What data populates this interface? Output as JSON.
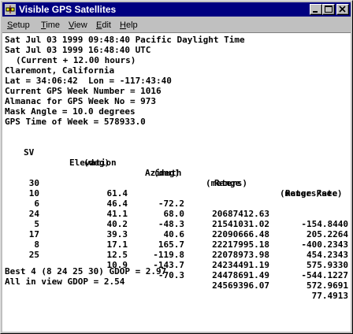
{
  "window": {
    "title": "Visible GPS Satellites",
    "icon": "satellite-app-icon"
  },
  "menu": [
    {
      "label": "Setup",
      "accel": "S",
      "rest": "etup"
    },
    {
      "label": "Time",
      "accel": "T",
      "rest": "ime"
    },
    {
      "label": "View",
      "accel": "V",
      "rest": "iew"
    },
    {
      "label": "Edit",
      "accel": "E",
      "rest": "dit"
    },
    {
      "label": "Help",
      "accel": "H",
      "rest": "elp"
    }
  ],
  "info": {
    "local_time": "Sat Jul 03 1999 09:48:40 Pacific Daylight Time",
    "utc_time": "Sat Jul 03 1999 16:48:40 UTC",
    "offset": "(Current + 12.00 hours)",
    "location": "Claremont, California",
    "coords": "Lat = 34:06:42  Lon = -117:43:40",
    "gps_week": "Current GPS Week Number = 1016",
    "almanac_week": "Almanac for GPS Week No = 973",
    "mask_angle": "Mask Angle = 10.0 degrees",
    "gps_time_of_week": "GPS Time of Week = 578933.0"
  },
  "table": {
    "headers": {
      "sv": "SV",
      "elevation": "Elevation",
      "azimuth": "Azimuth",
      "range": "Range",
      "range_rate": "Range Rate",
      "elevation_unit": "(deg)",
      "azimuth_unit": "(deg)",
      "range_unit": "(meters)",
      "range_rate_unit": "(meters/sec)"
    },
    "rows": [
      {
        "sv": "30",
        "elevation": "61.4",
        "azimuth": "-72.2",
        "range": "20687412.63",
        "range_rate": "-154.8440"
      },
      {
        "sv": "10",
        "elevation": "46.4",
        "azimuth": "68.0",
        "range": "21541031.02",
        "range_rate": "205.2264"
      },
      {
        "sv": "6",
        "elevation": "41.1",
        "azimuth": "-48.3",
        "range": "22090666.48",
        "range_rate": "-400.2343"
      },
      {
        "sv": "24",
        "elevation": "40.2",
        "azimuth": "40.6",
        "range": "22217995.18",
        "range_rate": "454.2343"
      },
      {
        "sv": "5",
        "elevation": "39.3",
        "azimuth": "165.7",
        "range": "22078973.98",
        "range_rate": "575.9330"
      },
      {
        "sv": "17",
        "elevation": "17.1",
        "azimuth": "-119.8",
        "range": "24234491.19",
        "range_rate": "-544.1227"
      },
      {
        "sv": "8",
        "elevation": "12.5",
        "azimuth": "-143.7",
        "range": "24478691.49",
        "range_rate": "572.9691"
      },
      {
        "sv": "25",
        "elevation": "10.9",
        "azimuth": "-70.3",
        "range": "24569396.07",
        "range_rate": "77.4913"
      }
    ]
  },
  "summary": {
    "best4": "Best 4 (8 24 25 30) GDOP = 2.97",
    "all_in_view": "All in view GDOP = 2.54"
  },
  "colors": {
    "titlebar": "#000080",
    "window_face": "#c0c0c0",
    "client_bg": "#ffffff",
    "text": "#000000"
  }
}
